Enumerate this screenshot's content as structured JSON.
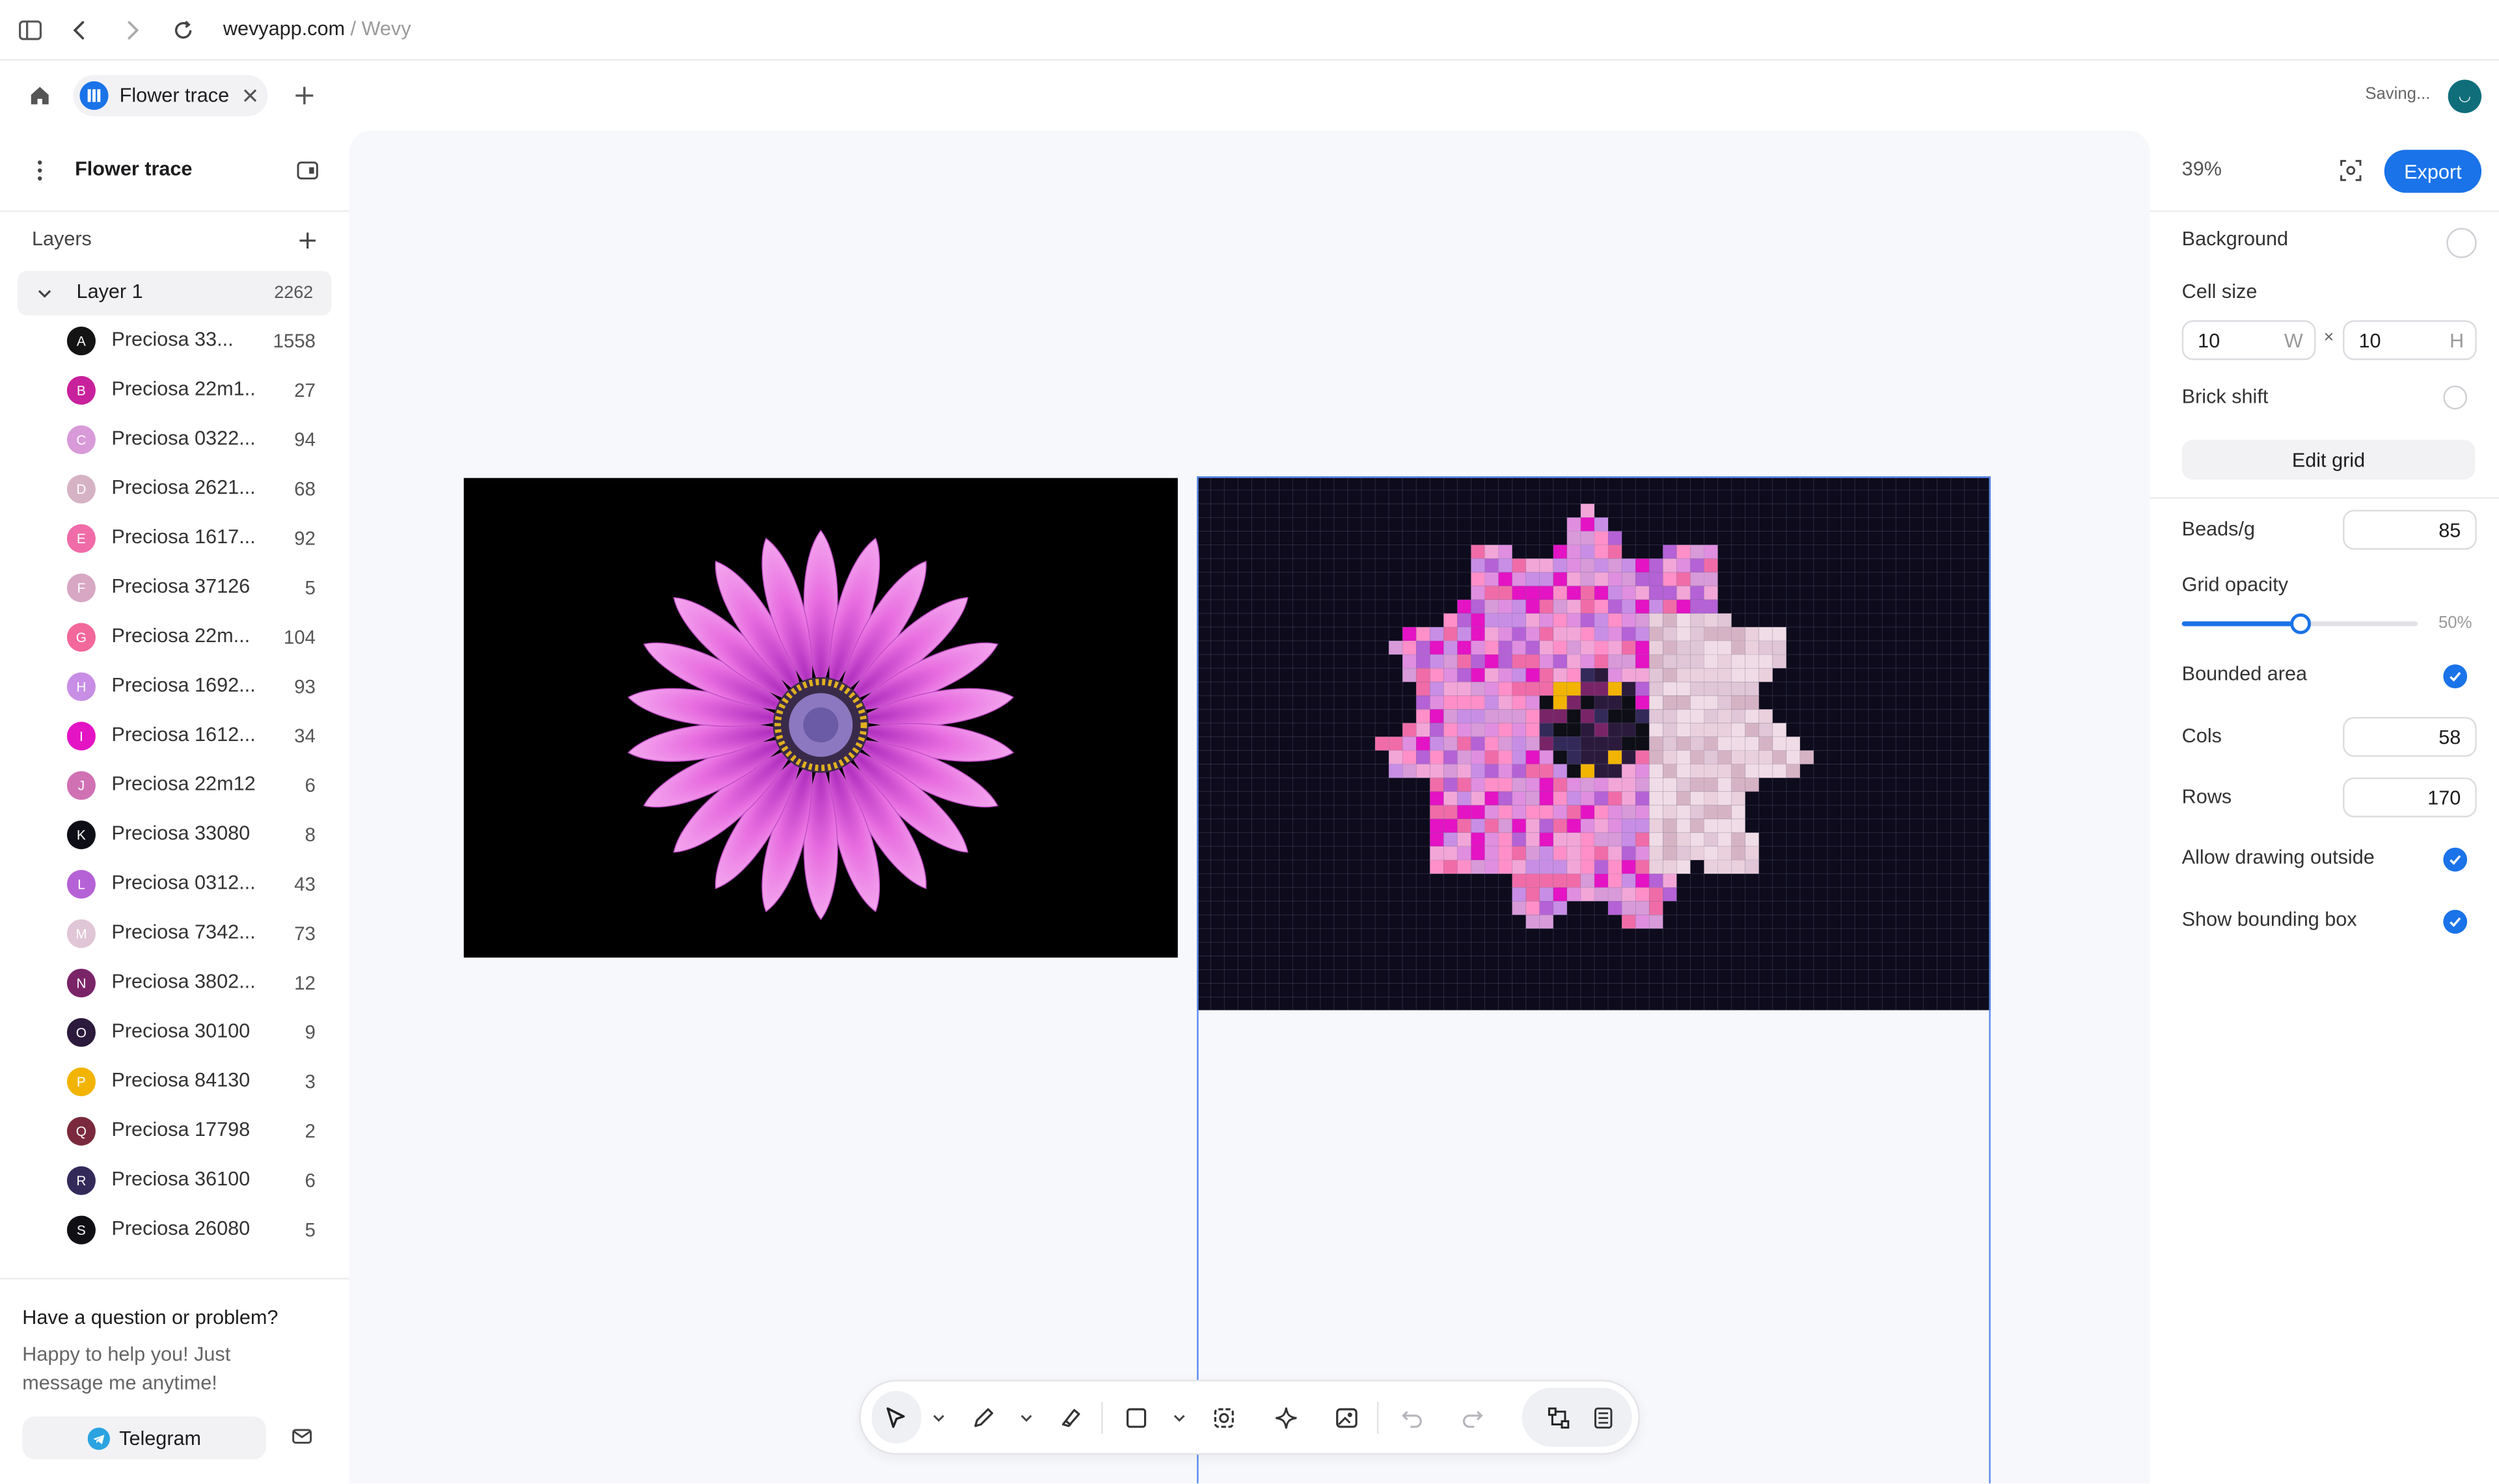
{
  "browser": {
    "domain": "wevyapp.com",
    "site": " / Wevy"
  },
  "tab": {
    "title": "Flower trace"
  },
  "status": {
    "saving": "Saving..."
  },
  "sidebar": {
    "title": "Flower trace",
    "layers_heading": "Layers",
    "layer": {
      "name": "Layer 1",
      "count": "2262"
    },
    "colors": [
      {
        "letter": "A",
        "name": "Preciosa 33...",
        "count": "1558",
        "color": "#141414"
      },
      {
        "letter": "B",
        "name": "Preciosa 22m1...",
        "count": "27",
        "color": "#c8219c"
      },
      {
        "letter": "C",
        "name": "Preciosa 0322...",
        "count": "94",
        "color": "#d89ad8"
      },
      {
        "letter": "D",
        "name": "Preciosa 2621...",
        "count": "68",
        "color": "#d6b3c4"
      },
      {
        "letter": "E",
        "name": "Preciosa 1617...",
        "count": "92",
        "color": "#f06ca8"
      },
      {
        "letter": "F",
        "name": "Preciosa 37126 ...",
        "count": "5",
        "color": "#d7a7c3"
      },
      {
        "letter": "G",
        "name": "Preciosa 22m...",
        "count": "104",
        "color": "#f2689a"
      },
      {
        "letter": "H",
        "name": "Preciosa 1692...",
        "count": "93",
        "color": "#c88ee6"
      },
      {
        "letter": "I",
        "name": "Preciosa 1612...",
        "count": "34",
        "color": "#e413c4"
      },
      {
        "letter": "J",
        "name": "Preciosa 22m12...",
        "count": "6",
        "color": "#d071b4"
      },
      {
        "letter": "K",
        "name": "Preciosa 33080 ...",
        "count": "8",
        "color": "#0e0e16"
      },
      {
        "letter": "L",
        "name": "Preciosa 0312...",
        "count": "43",
        "color": "#b562d6"
      },
      {
        "letter": "M",
        "name": "Preciosa 7342...",
        "count": "73",
        "color": "#e0c6d6"
      },
      {
        "letter": "N",
        "name": "Preciosa 3802...",
        "count": "12",
        "color": "#7a2468"
      },
      {
        "letter": "O",
        "name": "Preciosa 30100 ...",
        "count": "9",
        "color": "#2b1a3c"
      },
      {
        "letter": "P",
        "name": "Preciosa 84130 ...",
        "count": "3",
        "color": "#f2b400"
      },
      {
        "letter": "Q",
        "name": "Preciosa 17798 ...",
        "count": "2",
        "color": "#7a2a3c"
      },
      {
        "letter": "R",
        "name": "Preciosa 36100 ...",
        "count": "6",
        "color": "#332a5a"
      },
      {
        "letter": "S",
        "name": "Preciosa 26080 ...",
        "count": "5",
        "color": "#101014"
      }
    ]
  },
  "help": {
    "title": "Have a question or problem?",
    "text": "Happy to help you! Just message me anytime!",
    "telegram": "Telegram"
  },
  "right": {
    "zoom": "39%",
    "export": "Export",
    "background": "Background",
    "cell_size": "Cell size",
    "w_value": "10",
    "w_unit": "W",
    "times": "×",
    "h_value": "10",
    "h_unit": "H",
    "brick_shift": "Brick shift",
    "edit_grid": "Edit grid",
    "beads_label": "Beads/g",
    "beads_value": "85",
    "grid_opacity": "Grid opacity",
    "opacity_value": "50%",
    "opacity_fraction": 0.5,
    "bounded_area": "Bounded area",
    "cols_label": "Cols",
    "cols_value": "58",
    "rows_label": "Rows",
    "rows_value": "170",
    "allow_drawing": "Allow drawing outside",
    "show_bbox": "Show bounding box"
  }
}
